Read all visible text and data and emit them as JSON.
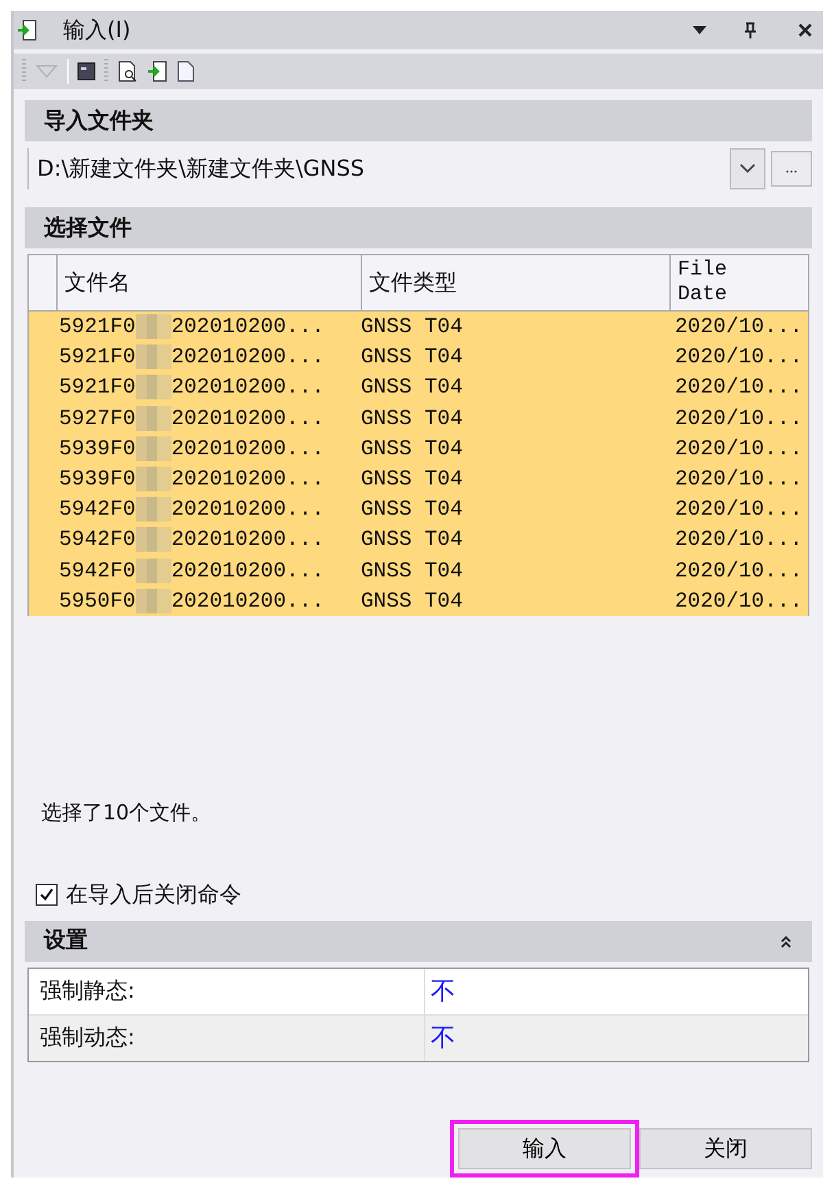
{
  "window": {
    "title": "输入(I)"
  },
  "toolbar": {
    "buttons": [
      {
        "kind": "dropdown",
        "disabled": true
      },
      {
        "kind": "console"
      },
      {
        "kind": "preview"
      },
      {
        "kind": "import"
      },
      {
        "kind": "document"
      }
    ]
  },
  "import_folder": {
    "title": "导入文件夹",
    "path": "D:\\新建文件夹\\新建文件夹\\GNSS"
  },
  "select_files": {
    "title": "选择文件",
    "columns": [
      "文件名",
      "文件类型",
      "File Date"
    ],
    "rows": [
      {
        "name_start": "5921F0",
        "name_end": "202010200...",
        "type": "GNSS T04",
        "date": "2020/10...",
        "selected": true
      },
      {
        "name_start": "5921F0",
        "name_end": "202010200...",
        "type": "GNSS T04",
        "date": "2020/10...",
        "selected": true
      },
      {
        "name_start": "5921F0",
        "name_end": "202010200...",
        "type": "GNSS T04",
        "date": "2020/10...",
        "selected": true
      },
      {
        "name_start": "5927F0",
        "name_end": "202010200...",
        "type": "GNSS T04",
        "date": "2020/10...",
        "selected": true
      },
      {
        "name_start": "5939F0",
        "name_end": "202010200...",
        "type": "GNSS T04",
        "date": "2020/10...",
        "selected": true
      },
      {
        "name_start": "5939F0",
        "name_end": "202010200...",
        "type": "GNSS T04",
        "date": "2020/10...",
        "selected": true
      },
      {
        "name_start": "5942F0",
        "name_end": "202010200...",
        "type": "GNSS T04",
        "date": "2020/10...",
        "selected": true
      },
      {
        "name_start": "5942F0",
        "name_end": "202010200...",
        "type": "GNSS T04",
        "date": "2020/10...",
        "selected": true
      },
      {
        "name_start": "5942F0",
        "name_end": "202010200...",
        "type": "GNSS T04",
        "date": "2020/10...",
        "selected": true
      },
      {
        "name_start": "5950F0",
        "name_end": "202010200...",
        "type": "GNSS T04",
        "date": "2020/10...",
        "selected": true
      }
    ],
    "summary": "选择了10个文件。"
  },
  "close_after_import": {
    "label": "在导入后关闭命令",
    "checked": true
  },
  "settings": {
    "title": "设置",
    "expanded": true,
    "properties": [
      {
        "label": "强制静态:",
        "value": "不",
        "selected": true
      },
      {
        "label": "强制动态:",
        "value": "不",
        "selected": false
      }
    ]
  },
  "buttons": [
    {
      "label": "输入",
      "highlighted": true
    },
    {
      "label": "关闭",
      "highlighted": false
    }
  ]
}
